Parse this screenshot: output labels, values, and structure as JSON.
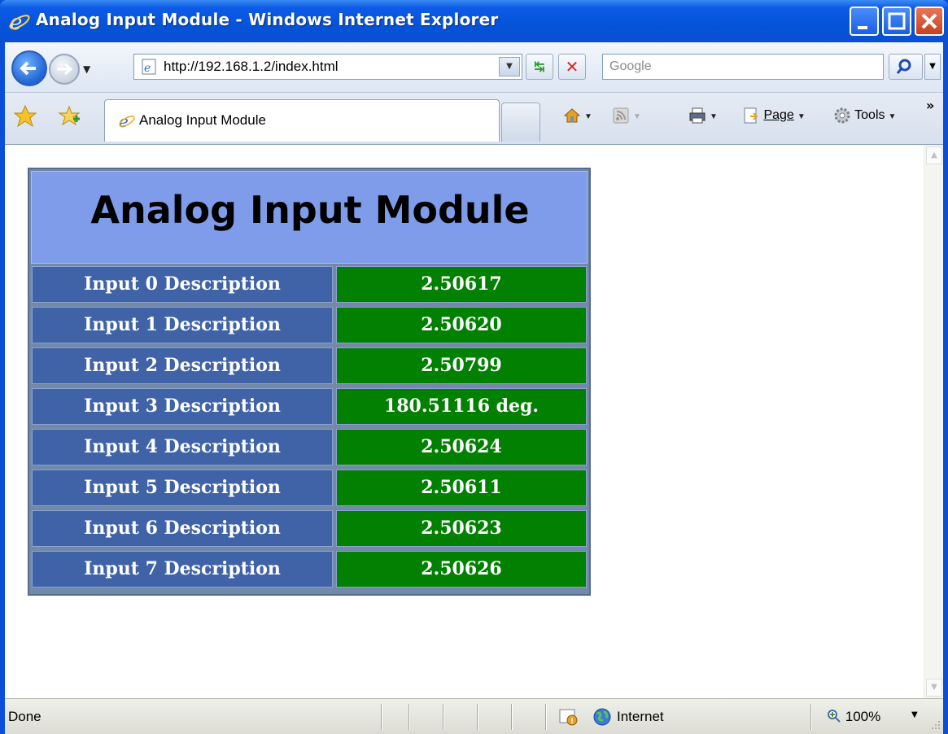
{
  "window": {
    "title": "Analog Input Module - Windows Internet Explorer"
  },
  "nav": {
    "address": "http://192.168.1.2/index.html",
    "search_placeholder": "Google"
  },
  "tabs": [
    {
      "label": "Analog Input Module"
    }
  ],
  "commands": {
    "page_label": "Page",
    "tools_label": "Tools"
  },
  "page": {
    "title": "Analog Input Module",
    "inputs": [
      {
        "label": "Input 0 Description",
        "value": "2.50617"
      },
      {
        "label": "Input 1 Description",
        "value": "2.50620"
      },
      {
        "label": "Input 2 Description",
        "value": "2.50799"
      },
      {
        "label": "Input 3 Description",
        "value": "180.51116 deg."
      },
      {
        "label": "Input 4 Description",
        "value": "2.50624"
      },
      {
        "label": "Input 5 Description",
        "value": "2.50611"
      },
      {
        "label": "Input 6 Description",
        "value": "2.50623"
      },
      {
        "label": "Input 7 Description",
        "value": "2.50626"
      }
    ]
  },
  "status": {
    "text": "Done",
    "zone": "Internet",
    "zoom": "100%"
  },
  "colors": {
    "header_bg": "#7f9cea",
    "label_bg": "#3f63a6",
    "value_bg": "#028002",
    "titlebar": "#0553d8"
  },
  "icons": [
    "ie-logo-icon",
    "back-arrow-icon",
    "forward-arrow-icon",
    "page-icon",
    "refresh-icon",
    "stop-icon",
    "search-icon",
    "favorites-star-icon",
    "add-favorites-icon",
    "home-icon",
    "feeds-icon",
    "print-icon",
    "page-menu-icon",
    "tools-gear-icon",
    "protected-mode-icon",
    "globe-icon",
    "zoom-icon"
  ]
}
